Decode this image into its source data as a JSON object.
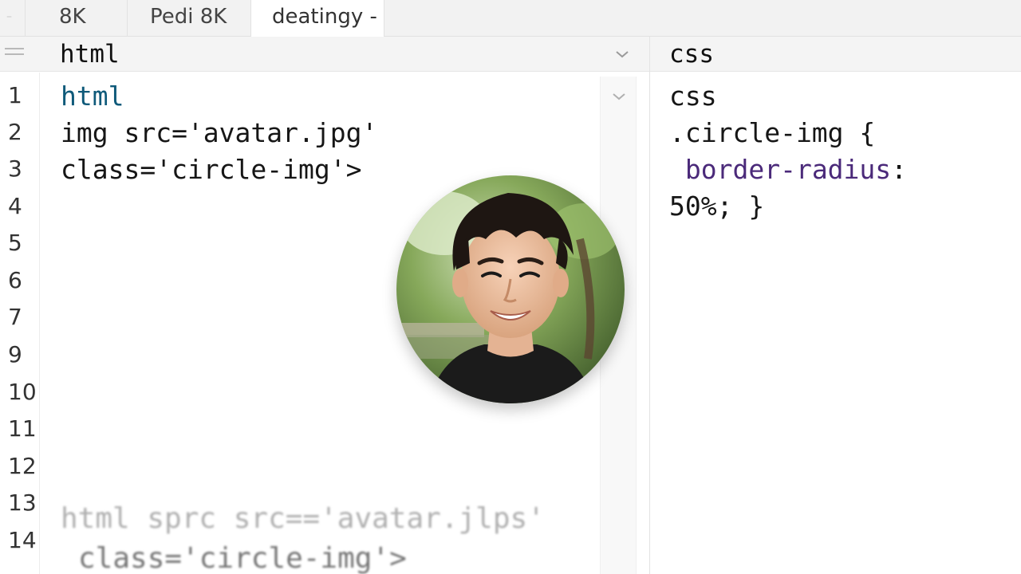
{
  "tabs": [
    {
      "label": "8K",
      "active": false
    },
    {
      "label": "Pedi 8K",
      "active": false
    },
    {
      "label": "deatingy -",
      "active": true
    }
  ],
  "html_pane": {
    "title": "html",
    "line_numbers": [
      "1",
      "2",
      "3",
      "4",
      "5",
      "6",
      "7",
      "9",
      "10",
      "11",
      "12",
      "13",
      "14"
    ],
    "lines": {
      "l1": "html",
      "l2": "img src='avatar.jpg'",
      "l3": "class='circle-img'>"
    },
    "ghost_lines": {
      "g1": "html sprc src=='avatar.jlps'",
      "g2": "class='circle-img'>"
    }
  },
  "css_pane": {
    "title": "css",
    "lines": {
      "l1": "css",
      "l2": ".circle-img {",
      "l3_prop": "border-radius",
      "l3_colon": ":",
      "l4": "50%; }"
    }
  },
  "icons": {
    "menu": "hamburger-icon",
    "dropdown": "chevron-down-icon"
  },
  "colors": {
    "keyword": "#0f5a7a",
    "property": "#4b2a7a",
    "tabbar": "#f2f2f2"
  }
}
